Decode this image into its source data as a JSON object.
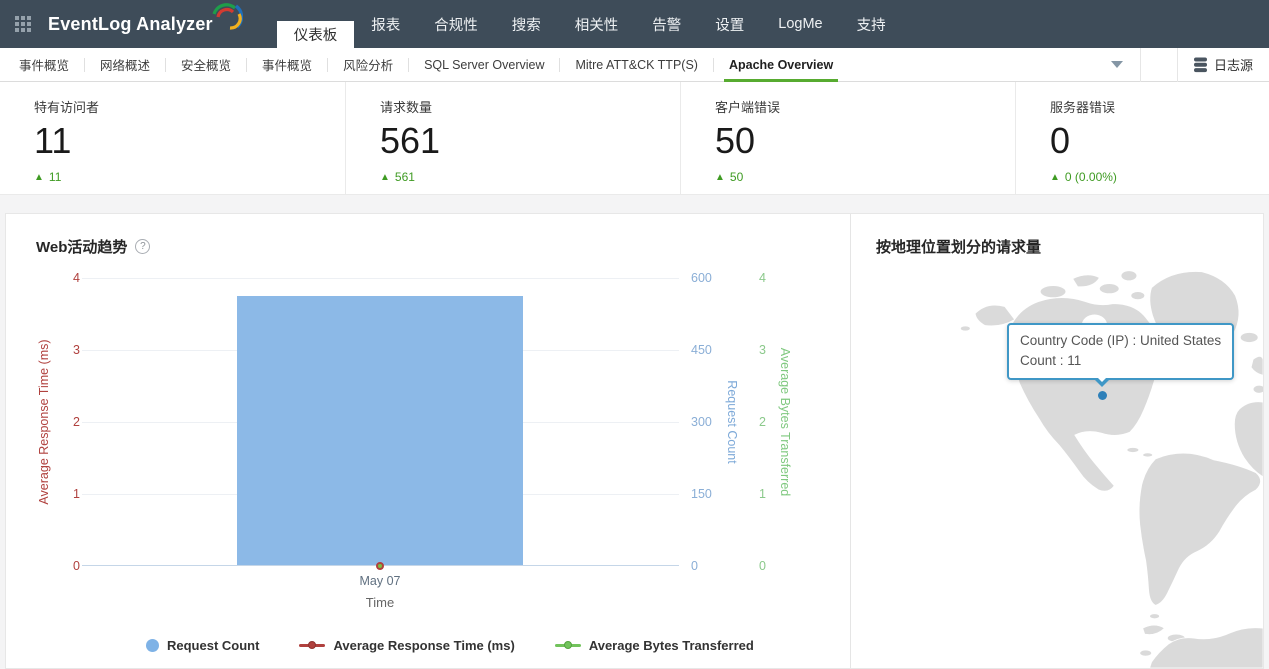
{
  "topnav": {
    "product": "EventLog Analyzer",
    "tabs": [
      {
        "label": "仪表板",
        "active": true
      },
      {
        "label": "报表"
      },
      {
        "label": "合规性"
      },
      {
        "label": "搜索"
      },
      {
        "label": "相关性"
      },
      {
        "label": "告警"
      },
      {
        "label": "设置"
      },
      {
        "label": "LogMe"
      },
      {
        "label": "支持"
      }
    ]
  },
  "subnav": {
    "items": [
      {
        "label": "事件概览"
      },
      {
        "label": "网络概述"
      },
      {
        "label": "安全概览"
      },
      {
        "label": "事件概览"
      },
      {
        "label": "风险分析"
      },
      {
        "label": "SQL Server Overview"
      },
      {
        "label": "Mitre ATT&CK TTP(S)"
      },
      {
        "label": "Apache Overview",
        "active": true
      }
    ],
    "log_sources_label": "日志源"
  },
  "stats": [
    {
      "label": "特有访问者",
      "value": "11",
      "delta": "11"
    },
    {
      "label": "请求数量",
      "value": "561",
      "delta": "561"
    },
    {
      "label": "客户端错误",
      "value": "50",
      "delta": "50"
    },
    {
      "label": "服务器错误",
      "value": "0",
      "delta": "0 (0.00%)"
    }
  ],
  "trend_panel": {
    "title": "Web活动趋势",
    "x_tick": "May 07",
    "x_axis_label": "Time",
    "left_axis_label": "Average Response Time (ms)",
    "right_axis1_label": "Request Count",
    "right_axis2_label": "Average Bytes Transferred",
    "left_ticks": [
      "4",
      "3",
      "2",
      "1",
      "0"
    ],
    "request_ticks": [
      "600",
      "450",
      "300",
      "150",
      "0"
    ],
    "bytes_ticks": [
      "4",
      "3",
      "2",
      "1",
      "0"
    ],
    "legend": [
      {
        "label": "Request Count"
      },
      {
        "label": "Average Response Time (ms)"
      },
      {
        "label": "Average Bytes Transferred"
      }
    ]
  },
  "chart_data": {
    "type": "bar",
    "title": "Web活动趋势",
    "categories": [
      "May 07"
    ],
    "xlabel": "Time",
    "series": [
      {
        "name": "Request Count",
        "type": "bar",
        "axis": "right1",
        "values": [
          561
        ],
        "color": "#8cb9e7"
      },
      {
        "name": "Average Response Time (ms)",
        "type": "line",
        "axis": "left",
        "values": [
          0
        ],
        "color": "#b0413e"
      },
      {
        "name": "Average Bytes Transferred",
        "type": "line",
        "axis": "right2",
        "values": [
          0
        ],
        "color": "#72c35c"
      }
    ],
    "axes": {
      "left": {
        "label": "Average Response Time (ms)",
        "range": [
          0,
          4
        ]
      },
      "right1": {
        "label": "Request Count",
        "range": [
          0,
          600
        ]
      },
      "right2": {
        "label": "Average Bytes Transferred",
        "range": [
          0,
          4
        ]
      }
    },
    "legend_position": "bottom",
    "grid": true
  },
  "map_panel": {
    "title": "按地理位置划分的请求量",
    "tooltip": {
      "line1": "Country Code (IP) : United States",
      "line2": "Count : 11"
    },
    "marker": {
      "country": "United States",
      "count": 11
    }
  },
  "icons": {
    "up_arrow": "▲",
    "help": "?"
  },
  "colors": {
    "topnav_bg": "#3e4c59",
    "active_underline": "#57ab30",
    "delta_green": "#3f9b23",
    "bar_blue": "#8cb9e7",
    "axis_red": "#b0413e",
    "axis_blue": "#7da9d8",
    "axis_green": "#7fc87f",
    "tooltip_border": "#3f97c6",
    "map_land": "#dadada",
    "map_dot": "#2e80b9"
  }
}
